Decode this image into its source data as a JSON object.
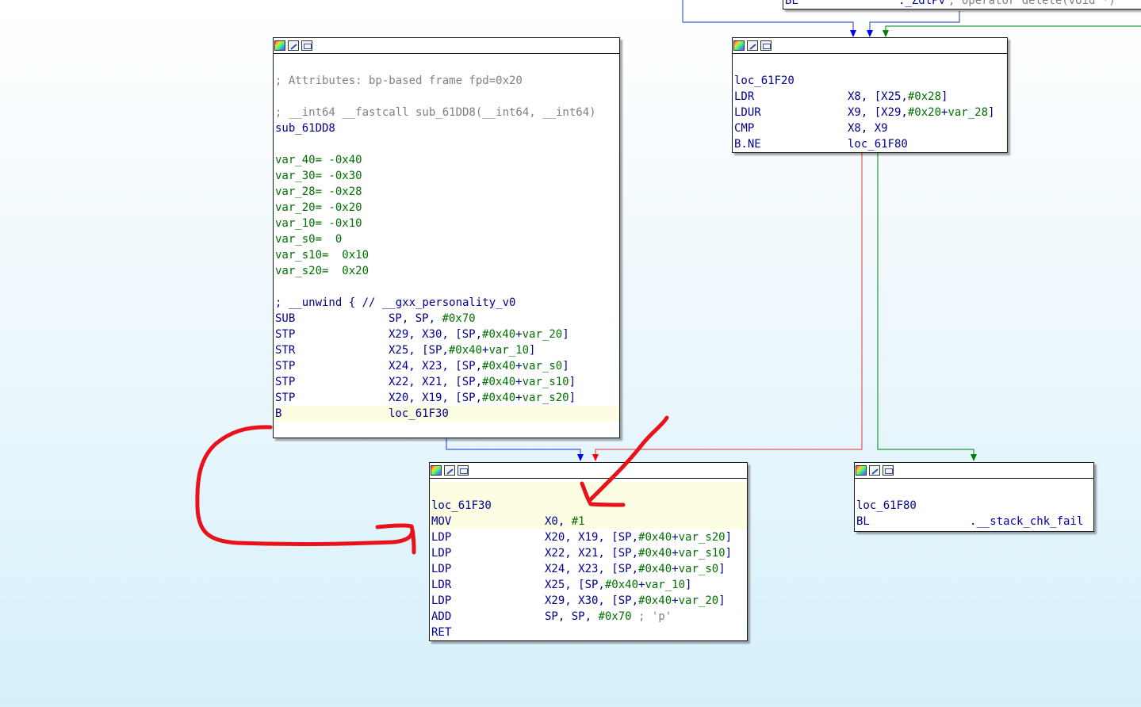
{
  "top_fragment": {
    "mnemonic": "BL",
    "operand": "._ZdlPv",
    "comment": "; operator delete(void *)"
  },
  "block_sub": {
    "lines": [
      {
        "kind": "blank"
      },
      {
        "kind": "comment",
        "text": "; Attributes: bp-based frame fpd=0x20"
      },
      {
        "kind": "blank"
      },
      {
        "kind": "comment",
        "text": "; __int64 __fastcall sub_61DD8(__int64, __int64)"
      },
      {
        "kind": "label",
        "text": "sub_61DD8"
      },
      {
        "kind": "blank"
      },
      {
        "kind": "var",
        "name": "var_40",
        "value": "= -0x40"
      },
      {
        "kind": "var",
        "name": "var_30",
        "value": "= -0x30"
      },
      {
        "kind": "var",
        "name": "var_28",
        "value": "= -0x28"
      },
      {
        "kind": "var",
        "name": "var_20",
        "value": "= -0x20"
      },
      {
        "kind": "var",
        "name": "var_10",
        "value": "= -0x10"
      },
      {
        "kind": "var",
        "name": "var_s0",
        "value": "=  0"
      },
      {
        "kind": "var",
        "name": "var_s10",
        "value": "=  0x10"
      },
      {
        "kind": "var",
        "name": "var_s20",
        "value": "=  0x20"
      },
      {
        "kind": "blank"
      },
      {
        "kind": "unwind",
        "text": "; __unwind { // __gxx_personality_v0"
      },
      {
        "kind": "insn",
        "mnemonic": "SUB",
        "operands": "SP, SP, #0x70"
      },
      {
        "kind": "insn",
        "mnemonic": "STP",
        "operands": "X29, X30, [SP,#0x40+var_20]"
      },
      {
        "kind": "insn",
        "mnemonic": "STR",
        "operands": "X25, [SP,#0x40+var_10]"
      },
      {
        "kind": "insn",
        "mnemonic": "STP",
        "operands": "X24, X23, [SP,#0x40+var_s0]"
      },
      {
        "kind": "insn",
        "mnemonic": "STP",
        "operands": "X22, X21, [SP,#0x40+var_s10]"
      },
      {
        "kind": "insn",
        "mnemonic": "STP",
        "operands": "X20, X19, [SP,#0x40+var_s20]"
      },
      {
        "kind": "insn",
        "mnemonic": "B",
        "operands": "loc_61F30",
        "highlight": true
      }
    ]
  },
  "block_61F20": {
    "lines": [
      {
        "kind": "blank"
      },
      {
        "kind": "label",
        "text": "loc_61F20"
      },
      {
        "kind": "insn",
        "mnemonic": "LDR",
        "operands": "X8, [X25,#0x28]"
      },
      {
        "kind": "insn",
        "mnemonic": "LDUR",
        "operands": "X9, [X29,#0x20+var_28]"
      },
      {
        "kind": "insn",
        "mnemonic": "CMP",
        "operands": "X8, X9"
      },
      {
        "kind": "insn",
        "mnemonic": "B.NE",
        "operands": "loc_61F80"
      }
    ]
  },
  "block_61F30": {
    "lines": [
      {
        "kind": "blank",
        "highlight": true
      },
      {
        "kind": "label",
        "text": "loc_61F30",
        "highlight": true
      },
      {
        "kind": "insn",
        "mnemonic": "MOV",
        "operands": "X0, #1",
        "highlight": true
      },
      {
        "kind": "insn",
        "mnemonic": "LDP",
        "operands": "X20, X19, [SP,#0x40+var_s20]"
      },
      {
        "kind": "insn",
        "mnemonic": "LDP",
        "operands": "X22, X21, [SP,#0x40+var_s10]"
      },
      {
        "kind": "insn",
        "mnemonic": "LDP",
        "operands": "X24, X23, [SP,#0x40+var_s0]"
      },
      {
        "kind": "insn",
        "mnemonic": "LDR",
        "operands": "X25, [SP,#0x40+var_10]"
      },
      {
        "kind": "insn",
        "mnemonic": "LDP",
        "operands": "X29, X30, [SP,#0x40+var_20]"
      },
      {
        "kind": "insn",
        "mnemonic": "ADD",
        "operands": "SP, SP, #0x70",
        "comment": " ; 'p'"
      },
      {
        "kind": "insn",
        "mnemonic": "RET",
        "operands": ""
      }
    ]
  },
  "block_61F80": {
    "lines": [
      {
        "kind": "blank"
      },
      {
        "kind": "label",
        "text": "loc_61F80"
      },
      {
        "kind": "insn",
        "mnemonic": "BL",
        "operands": ".__stack_chk_fail",
        "link": true
      }
    ]
  },
  "colors": {
    "edge_unconditional": "#0000ff",
    "edge_true": "#008000",
    "edge_false": "#ff0000",
    "annotation": "#e8121b",
    "highlight_line": "#fdfde3"
  }
}
